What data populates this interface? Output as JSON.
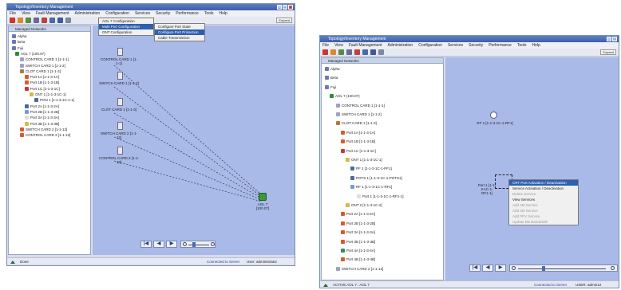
{
  "left_window": {
    "title": "Topology/Inventory Management",
    "menu": [
      "File",
      "View",
      "Fault Management",
      "Administration",
      "Configuration",
      "Services",
      "Security",
      "Performance",
      "Tools",
      "Help"
    ],
    "expand_label": "Expand",
    "tree_header": "Managed Networks",
    "tree": [
      "Alpha",
      "Beta",
      "Fuji",
      "AOL 7 (100.07)",
      "CONTROL CARD 1 [1-1-1]",
      "SWITCH CARD 1 [1-1-2]",
      "CLOT CARD 1 [1-1-3]",
      "Port 1A [1-1-3-1A]",
      "Port 1B [1-1-3-1B]",
      "Port 1C [1-1-3-1C]",
      "ONT 1 [1-1-3-1C-1]",
      "PON 1 [1-1-3-1C-1-1]",
      "Port 2A [1-1-3-2A]",
      "Port 2B [1-1-3-2B]",
      "Port 3A [1-1-3-3A]",
      "Port 3B [1-1-3-3B]",
      "SWITCH CARD 2 [1-1-12]",
      "CONTROL CARD 2 [1-1-13]"
    ],
    "config_menu": [
      "AOL 7 Configuration",
      "Multi Port Configuration",
      "ONT Configuration"
    ],
    "config_sub1": [
      "Configure Port State",
      "Configure Port Protection"
    ],
    "config_sub2": "Cable Transmission",
    "nodes": [
      "CONTROL CARD 1 [1-1-1]",
      "SWITCH CARD 1 [1-1-2]",
      "CLOT CARD 1 [1-1-3]",
      "SWITCH CARD 2 [1-1-12]",
      "CONTROL CARD 2 [1-1-13]",
      "AOL 7 [100.07]"
    ],
    "status": "Done",
    "conn_status": "Connected to Server",
    "user_status": "User: administrator"
  },
  "right_window": {
    "title": "Topology/Inventory Management",
    "menu": [
      "File",
      "View",
      "Fault Management",
      "Administration",
      "Configuration",
      "Services",
      "Security",
      "Performance",
      "Tools",
      "Help"
    ],
    "expand_label": "Expand",
    "tree_header": "Managed Networks",
    "tree": [
      "Alpha",
      "Beta",
      "Fuji",
      "AOL 7 (100.07)",
      "CONTROL CARD 1 [1-1-1]",
      "SWITCH CARD 1 [1-1-2]",
      "CLOT CARD 1 [1-1-3]",
      "Port 1A [1-1-3-1A]",
      "Port 1B [1-1-3-1B]",
      "Port 1C [1-1-3-1C]",
      "ONT 1 [1-1-3-1C-1]",
      "PF 1 [1-1-3-1C-1-PF1]",
      "POTS 1 [1-1-3-1C-1-POTS1]",
      "RF 1 [1-1-3-1C-1-RF1]",
      "Port 1 [1-1-3-1C-1-RF1-1]",
      "ONT 2 [1-1-3-1C-2]",
      "Port 2A [1-1-3-2A]",
      "Port 2B [1-1-3-2B]",
      "Port 3A [1-1-3-3A]",
      "Port 3B [1-1-3-3B]",
      "Port 4A [1-1-3-4A]",
      "Port 4B [1-1-3-4B]",
      "SWITCH CARD 2 [1-1-12]"
    ],
    "node_top": "RF 1 [1-1-3-1C-1-RF1]",
    "node_bottom": "Port 1 [1-1-3-1C-1-RF1-1]",
    "context_menu": [
      "CRT Port Activation / Deactivation",
      "Service Activation / Deactivation",
      "Delete Service",
      "View Services",
      "Add 4M Service",
      "Add 2M Service",
      "Add PPV Service",
      "Update DB Bandwidth"
    ],
    "status": "ACTIVE AOL 7 : AOL 7",
    "conn_status": "Connected to Server",
    "user_status": "USER: admin12"
  }
}
